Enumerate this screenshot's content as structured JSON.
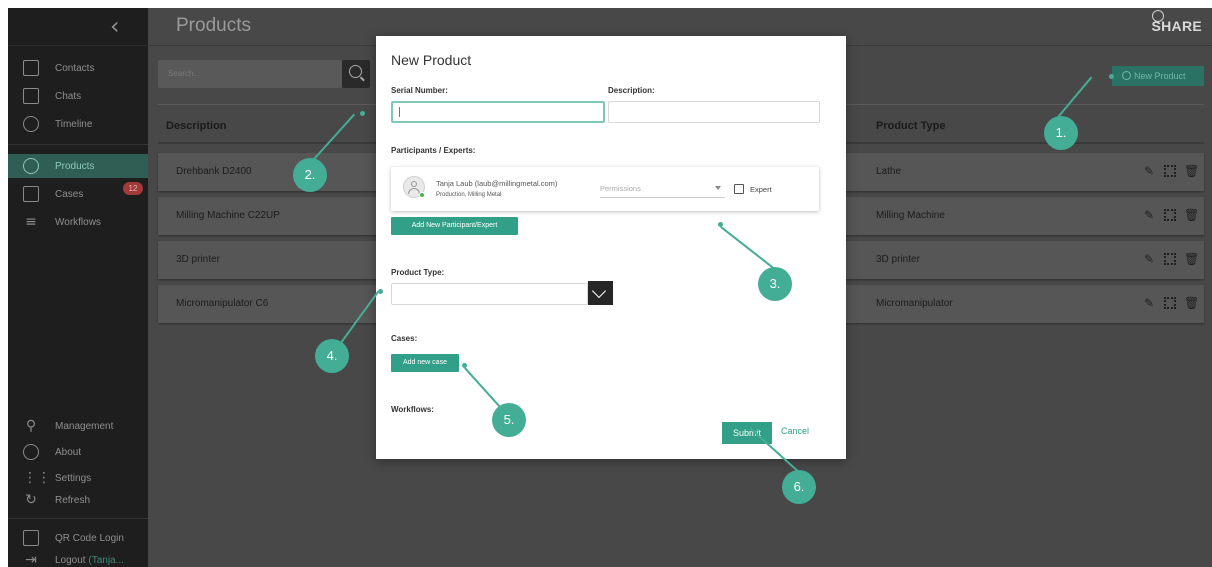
{
  "sidebar": {
    "items": [
      {
        "label": "Contacts",
        "icon": "contacts-icon"
      },
      {
        "label": "Chats",
        "icon": "chat-icon"
      },
      {
        "label": "Timeline",
        "icon": "clock-icon"
      },
      {
        "label": "Products",
        "icon": "products-icon",
        "active": true
      },
      {
        "label": "Cases",
        "icon": "document-icon",
        "badge": "12"
      },
      {
        "label": "Workflows",
        "icon": "workflow-icon"
      }
    ],
    "bottom": [
      {
        "label": "Management",
        "icon": "key-icon"
      },
      {
        "label": "About",
        "icon": "info-icon"
      },
      {
        "label": "Settings",
        "icon": "sliders-icon"
      },
      {
        "label": "Refresh",
        "icon": "refresh-icon"
      }
    ],
    "qr_login": "QR Code Login",
    "logout": "Logout",
    "logout_user": "(Tanja..."
  },
  "topbar": {
    "title": "Products",
    "brand": "SHARE"
  },
  "list": {
    "search_placeholder": "Search...",
    "new_product": "New Product",
    "columns": [
      "Description",
      "Product Type"
    ],
    "rows": [
      {
        "description": "Drehbank D2400",
        "type": "Lathe"
      },
      {
        "description": "Milling Machine C22UP",
        "type": "Milling Machine"
      },
      {
        "description": "3D printer",
        "type": "3D printer"
      },
      {
        "description": "Micromanipulator C6",
        "type": "Micromanipulator"
      }
    ]
  },
  "modal": {
    "title": "New Product",
    "serial_label": "Serial Number:",
    "description_label": "Description:",
    "participants_label": "Participants / Experts:",
    "participant": {
      "name": "Tanja Laub (laub@millingmetal.com)",
      "org": "Production, Milling Metal",
      "permissions_placeholder": "Permissions",
      "expert_label": "Expert"
    },
    "add_participant": "Add New Participant/Expert",
    "product_type_label": "Product Type:",
    "cases_label": "Cases:",
    "add_case": "Add new case",
    "workflows_label": "Workflows:",
    "submit": "Submit",
    "cancel": "Cancel"
  },
  "callouts": [
    "1.",
    "2.",
    "3.",
    "4.",
    "5.",
    "6."
  ],
  "colors": {
    "accent": "#44ad95",
    "sidebar_bg": "#1e1e1e",
    "overlay_bg": "#484848",
    "badge": "#a33a3a"
  }
}
